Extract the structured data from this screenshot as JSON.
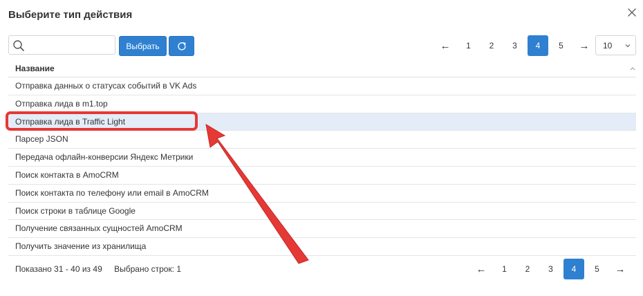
{
  "dialog": {
    "title": "Выберите тип действия",
    "close_icon": "close-icon"
  },
  "toolbar": {
    "search_value": "",
    "search_placeholder": "",
    "select_label": "Выбрать",
    "refresh_icon": "refresh-icon"
  },
  "pager_top": {
    "prev": "←",
    "pages": [
      "1",
      "2",
      "3",
      "4",
      "5"
    ],
    "active_page": "4",
    "next": "→"
  },
  "page_size": {
    "value": "10"
  },
  "table": {
    "column_header": "Название",
    "rows": [
      "Отправка данных о статусах событий в VK Ads",
      "Отправка лида в m1.top",
      "Отправка лида в Traffic Light",
      "Парсер JSON",
      "Передача офлайн-конверсии Яндекс Метрики",
      "Поиск контакта в AmoCRM",
      "Поиск контакта по телефону или email в AmoCRM",
      "Поиск строки в таблице Google",
      "Получение связанных сущностей AmoCRM",
      "Получить значение из хранилища"
    ],
    "selected_row": "Отправка лида в Traffic Light"
  },
  "footer": {
    "shown": "Показано 31 - 40 из 49",
    "selected_count": "Выбрано строк: 1"
  },
  "pager_bottom": {
    "prev": "←",
    "pages": [
      "1",
      "2",
      "3",
      "4",
      "5"
    ],
    "active_page": "4",
    "next": "→"
  },
  "colors": {
    "accent": "#2f80d1",
    "selected_row_bg": "#e3ecf7",
    "annotation_red": "#e53935"
  }
}
